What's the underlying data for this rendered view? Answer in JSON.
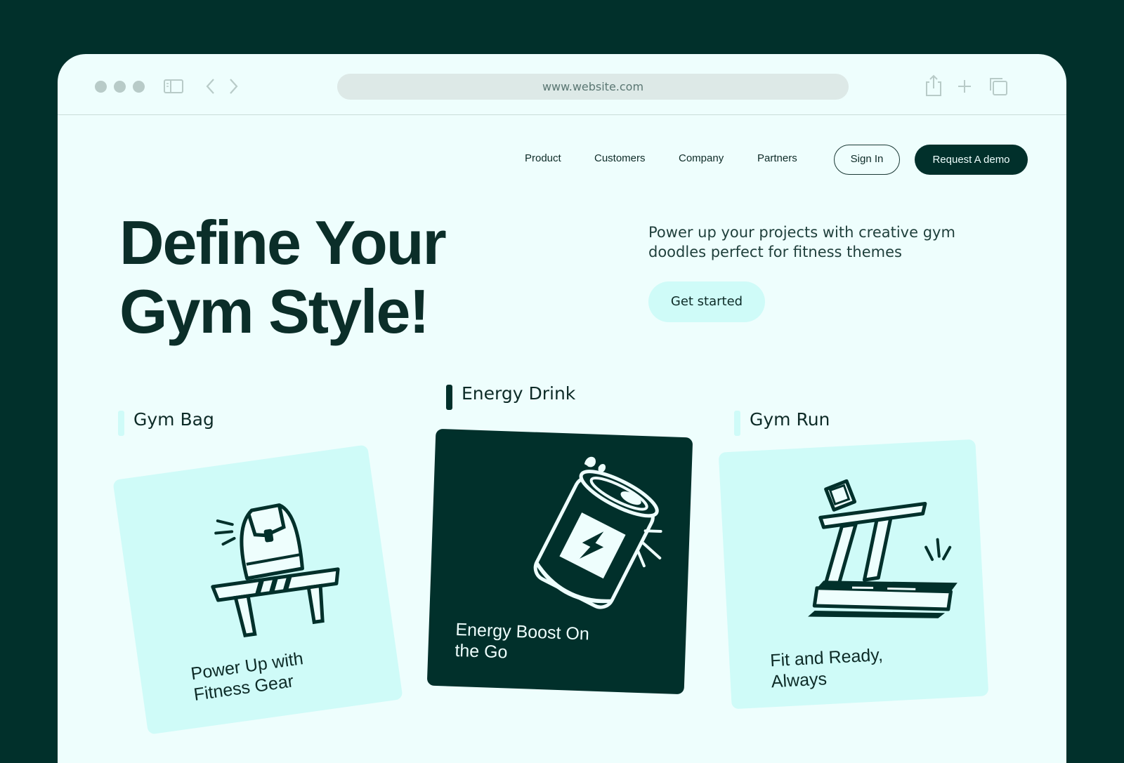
{
  "browser": {
    "url": "www.website.com",
    "icons": [
      "window-dot-icon",
      "sidebar-icon",
      "back-arrow-icon",
      "forward-arrow-icon",
      "share-icon",
      "new-tab-icon",
      "tabs-icon"
    ]
  },
  "nav": {
    "links": [
      "Product",
      "Customers",
      "Company",
      "Partners"
    ],
    "signin_label": "Sign In",
    "demo_label": "Request A demo"
  },
  "hero": {
    "title_line1": "Define Your",
    "title_line2": "Gym Style!",
    "subtitle": "Power up your projects with creative gym doodles perfect for fitness themes",
    "cta_label": "Get started"
  },
  "cards": [
    {
      "category": "Gym Bag",
      "caption_line1": "Power Up with",
      "caption_line2": "Fitness Gear",
      "icon": "gym-bag-icon"
    },
    {
      "category": "Energy Drink",
      "caption_line1": "Energy Boost On",
      "caption_line2": "the Go",
      "icon": "energy-drink-icon"
    },
    {
      "category": "Gym Run",
      "caption_line1": "Fit and Ready,",
      "caption_line2": "Always",
      "icon": "treadmill-icon"
    }
  ],
  "colors": {
    "background": "#01302b",
    "page": "#eefefd",
    "accent_light": "#cffbf8",
    "dark": "#01302b"
  }
}
